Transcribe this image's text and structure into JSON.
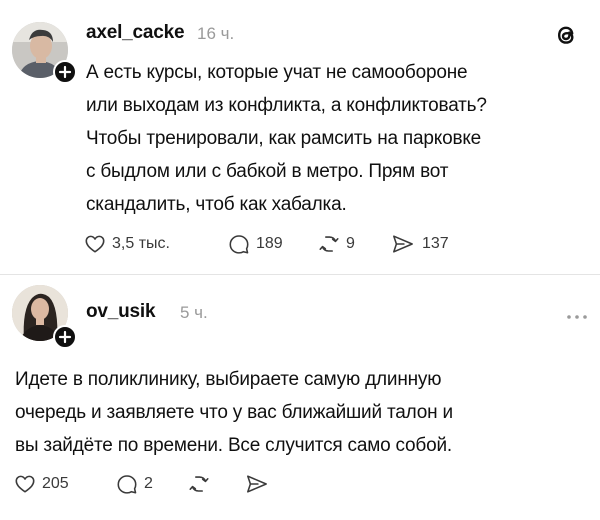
{
  "post1": {
    "username": "axel_cacke",
    "time": "16 ч.",
    "lines": [
      "А есть курсы, которые учат не самообороне",
      "или выходам из конфликта, а конфликтовать?",
      "Чтобы тренировали, как рамсить на парковке",
      "с быдлом или с бабкой в метро. Прям вот",
      "скандалить, чтоб как хабалка."
    ],
    "likes": "3,5 тыс.",
    "replies": "189",
    "reposts": "9",
    "shares": "137"
  },
  "post2": {
    "username": "ov_usik",
    "time": "5 ч.",
    "lines": [
      "Идете в поликлинику, выбираете самую длинную",
      "очередь и заявляете что у вас ближайший талон и",
      "вы зайдёте по времени. Все случится само собой."
    ],
    "likes": "205",
    "replies": "2"
  },
  "icons": {
    "top_right": "threads-logo-icon",
    "more": "more-dots-icon",
    "like": "heart-icon",
    "reply": "comment-icon",
    "repost": "repost-icon",
    "share": "send-icon",
    "follow": "plus-icon"
  }
}
